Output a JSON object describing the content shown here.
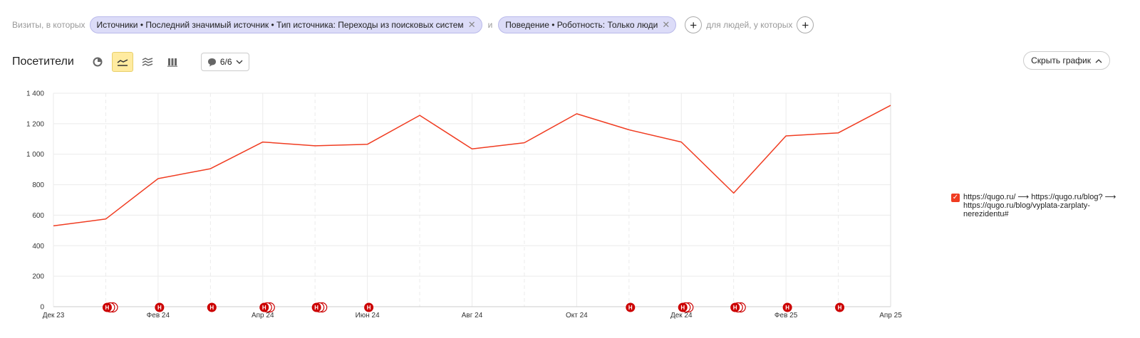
{
  "filters": {
    "prefix": "Визиты, в которых",
    "chip1": "Источники • Последний значимый источник • Тип источника: Переходы из поисковых систем",
    "conj": "и",
    "chip2": "Поведение • Роботность: Только люди",
    "people_label": "для людей, у которых"
  },
  "toolbar": {
    "title": "Посетители",
    "notes_count": "6/6",
    "hide_chart": "Скрыть график"
  },
  "legend": {
    "label": "https://qugo.ru/ ⟶ https://qugo.ru/blog? ⟶ https://qugo.ru/blog/vyplata-zarplaty-nerezidentu#"
  },
  "colors": {
    "line": "#f03c21",
    "grid": "#ebebeb",
    "marker": "#cc0000",
    "chip": "#dcdcf8",
    "active_button": "#ffeba0"
  },
  "chart_data": {
    "type": "line",
    "y_title": "",
    "ylim": [
      0,
      1400
    ],
    "y_ticks": [
      0,
      200,
      400,
      600,
      800,
      1000,
      1200,
      1400
    ],
    "y_tick_labels": [
      "0",
      "200",
      "400",
      "600",
      "800",
      "1 000",
      "1 200",
      "1 400"
    ],
    "x_labels": [
      "Дек 23",
      "Фев 24",
      "Апр 24",
      "Июн 24",
      "Авг 24",
      "Окт 24",
      "Дек 24",
      "Фев 25",
      "Апр 25"
    ],
    "grid": true,
    "legend_position": "right",
    "series": [
      {
        "name": "https://qugo.ru/ ⟶ https://qugo.ru/blog? ⟶ https://qugo.ru/blog/vyplata-zarplaty-nerezidentu#",
        "values": [
          530,
          575,
          840,
          905,
          1080,
          1055,
          1065,
          1255,
          1035,
          1075,
          1265,
          1160,
          1080,
          745,
          1120,
          1140,
          1320
        ]
      }
    ],
    "notes": [
      {
        "index": 1,
        "count": 3
      },
      {
        "index": 2,
        "count": 1
      },
      {
        "index": 3,
        "count": 1
      },
      {
        "index": 4,
        "count": 3
      },
      {
        "index": 5,
        "count": 3
      },
      {
        "index": 6,
        "count": 1
      },
      {
        "index": 11,
        "count": 1
      },
      {
        "index": 12,
        "count": 3
      },
      {
        "index": 13,
        "count": 3
      },
      {
        "index": 14,
        "count": 1
      },
      {
        "index": 15,
        "count": 1
      }
    ],
    "note_glyph": "Н"
  }
}
